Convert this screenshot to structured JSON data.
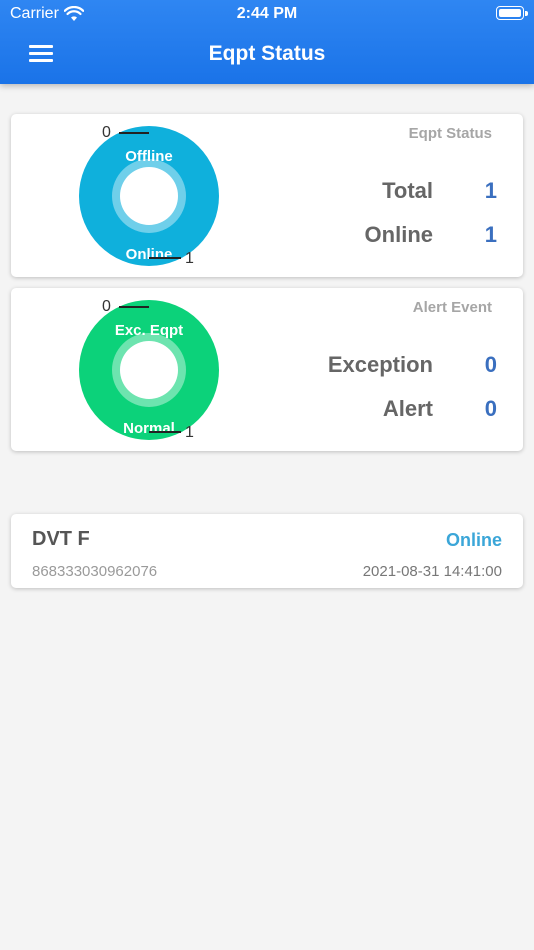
{
  "status_bar": {
    "carrier": "Carrier",
    "time": "2:44 PM"
  },
  "header": {
    "title": "Eqpt Status",
    "menu_icon": "hamburger-menu-icon"
  },
  "eqpt_card": {
    "title": "Eqpt Status",
    "donut": {
      "top_label": "Offline",
      "bottom_label": "Online",
      "top_value": "0",
      "bottom_value": "1",
      "colors": [
        "#0fb0dc"
      ]
    },
    "stats": [
      {
        "label": "Total",
        "value": "1"
      },
      {
        "label": "Online",
        "value": "1"
      }
    ]
  },
  "alert_card": {
    "title": "Alert Event",
    "donut": {
      "top_label": "Exc. Eqpt",
      "bottom_label": "Normal",
      "top_value": "0",
      "bottom_value": "1",
      "colors": [
        "#0cd27a"
      ]
    },
    "stats": [
      {
        "label": "Exception",
        "value": "0"
      },
      {
        "label": "Alert",
        "value": "0"
      }
    ]
  },
  "devices": [
    {
      "name": "DVT F",
      "status": "Online",
      "id": "868333030962076",
      "time": "2021-08-31 14:41:00"
    }
  ],
  "colors": {
    "header": "#1a73e8",
    "value": "#3a6fbf",
    "status_online": "#3ba6d8"
  }
}
